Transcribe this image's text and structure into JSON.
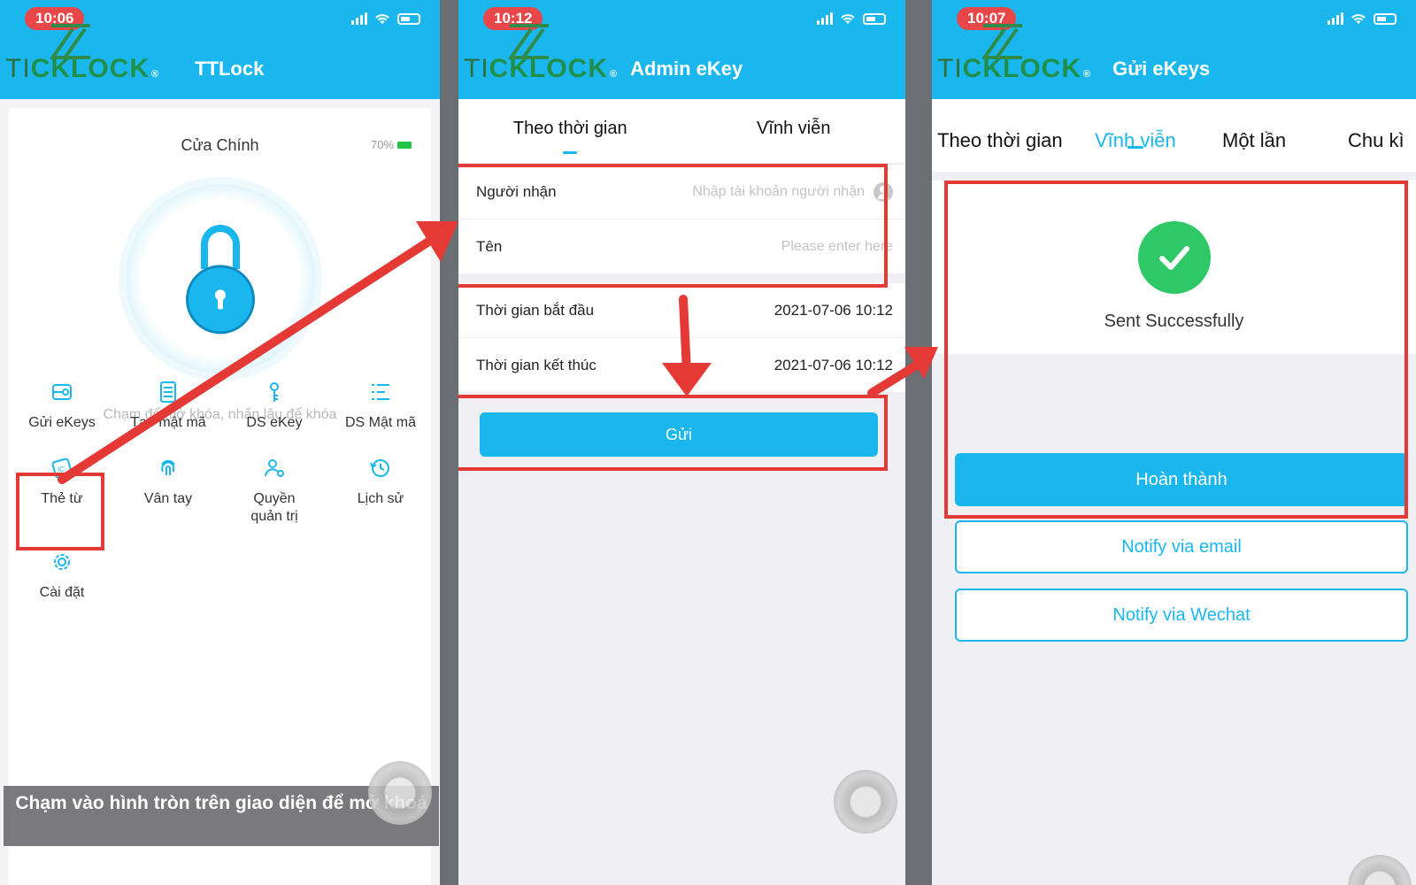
{
  "colors": {
    "accent": "#1ab7ee",
    "highlight": "#e53935",
    "success": "#2ec866",
    "brand_green": "#1f8f4a"
  },
  "brand": {
    "part1": "TI",
    "part2": "CKLOCK",
    "reg": "®"
  },
  "screen1": {
    "time": "10:06",
    "title": "TTLock",
    "lock_name": "Cửa Chính",
    "battery": "70%",
    "hint": "Chạm để mở khóa, nhấn lâu để khóa",
    "menu": [
      {
        "label": "Gửi eKeys",
        "icon": "send-ekey-icon"
      },
      {
        "label": "Tạo mật mã",
        "icon": "keypad-icon"
      },
      {
        "label": "DS eKey",
        "icon": "ekey-list-icon"
      },
      {
        "label": "DS Mật mã",
        "icon": "passcode-list-icon"
      },
      {
        "label": "Thẻ từ",
        "icon": "ic-card-icon"
      },
      {
        "label": "Vân tay",
        "icon": "fingerprint-icon"
      },
      {
        "label": "Quyền quản trị",
        "icon": "admin-icon"
      },
      {
        "label": "Lịch sử",
        "icon": "history-icon"
      },
      {
        "label": "Cài đặt",
        "icon": "settings-gear-icon"
      }
    ],
    "caption": "Chạm vào hình tròn trên giao diện để mở khoá"
  },
  "screen2": {
    "time": "10:12",
    "title": "Admin eKey",
    "tabs": [
      "Theo thời gian",
      "Vĩnh viễn"
    ],
    "recipient_label": "Người nhận",
    "recipient_placeholder": "Nhập tài khoản người nhận",
    "name_label": "Tên",
    "name_placeholder": "Please enter here",
    "start_label": "Thời gian bắt đầu",
    "start_value": "2021-07-06 10:12",
    "end_label": "Thời gian kết thúc",
    "end_value": "2021-07-06 10:12",
    "send_label": "Gửi"
  },
  "screen3": {
    "time": "10:07",
    "title": "Gửi eKeys",
    "tabs": [
      "Theo thời gian",
      "Vĩnh viễn",
      "Một lần",
      "Chu kì"
    ],
    "success_text": "Sent Successfully",
    "done_label": "Hoàn thành",
    "email_label": "Notify via email",
    "wechat_label": "Notify via Wechat"
  }
}
